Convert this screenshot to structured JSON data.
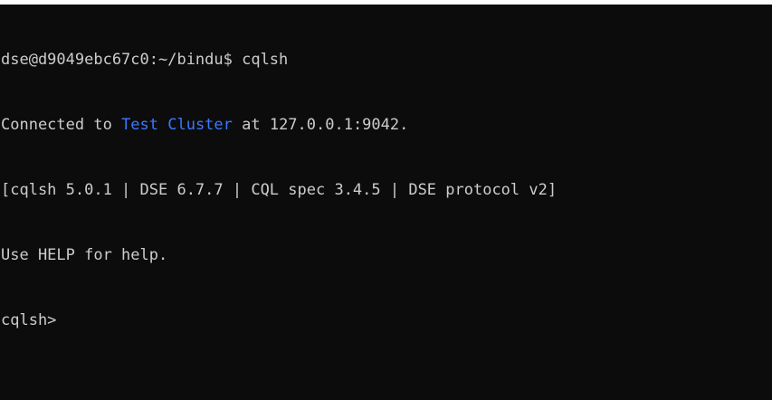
{
  "terminal": {
    "background": "#0c0c0c",
    "foreground": "#cccccc",
    "highlight_color": "#3b78ff",
    "lines": {
      "command_prompt": "dse@d9049ebc67c0:~/bindu$ cqlsh",
      "connected_prefix": "Connected to ",
      "cluster_name": "Test Cluster",
      "connected_suffix": " at 127.0.0.1:9042.",
      "version_info": "[cqlsh 5.0.1 | DSE 6.7.7 | CQL spec 3.4.5 | DSE protocol v2]",
      "help_hint": "Use HELP for help.",
      "cqlsh_prompt": "cqlsh>"
    },
    "current_input": ""
  }
}
